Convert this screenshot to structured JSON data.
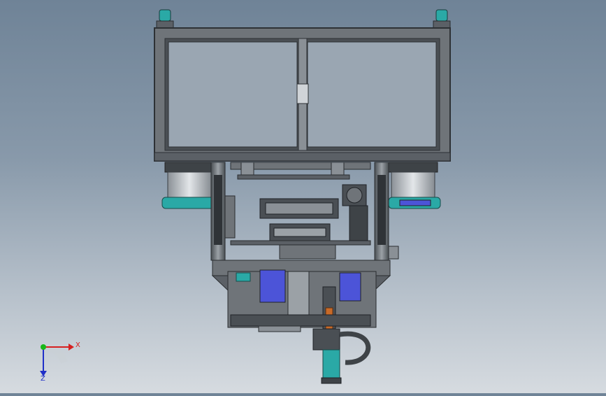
{
  "view": {
    "background_top": "#6f8397",
    "background_bottom": "#d6dbe0"
  },
  "triad": {
    "x_label": "X",
    "z_label": "Z",
    "x_color": "#d62020",
    "y_color": "#18b818",
    "z_color": "#2030c8"
  },
  "colors": {
    "frame": "#6f7479",
    "frame_dark": "#3e4347",
    "glass": "#9aa6b2",
    "teal": "#2aa9a6",
    "blue_part": "#4c54d8",
    "copper": "#c86a28",
    "drum": "#c9ced3"
  }
}
